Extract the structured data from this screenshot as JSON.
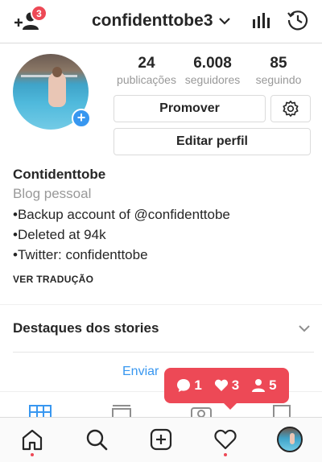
{
  "header": {
    "notifications_badge": "3",
    "username": "confidenttobe3"
  },
  "profile": {
    "stats": [
      {
        "value": "24",
        "label": "publicações"
      },
      {
        "value": "6.008",
        "label": "seguidores"
      },
      {
        "value": "85",
        "label": "seguindo"
      }
    ],
    "promote_label": "Promover",
    "edit_label": "Editar perfil",
    "name": "Contidenttobe",
    "category": "Blog pessoal",
    "bio_lines": [
      "•Backup account of @confidenttobe",
      "•Deleted at 94k",
      "•Twitter: confidenttobe"
    ],
    "translate_label": "VER TRADUÇÃO"
  },
  "highlights": {
    "title": "Destaques dos stories",
    "send_link": "Enviar"
  },
  "toast": {
    "comments": "1",
    "likes": "3",
    "follows": "5"
  },
  "bottom_nav": {
    "items": [
      "home",
      "search",
      "new-post",
      "activity",
      "profile"
    ]
  },
  "colors": {
    "accent_red": "#ed4956",
    "link_blue": "#3897f0",
    "muted_gray": "#999999"
  }
}
